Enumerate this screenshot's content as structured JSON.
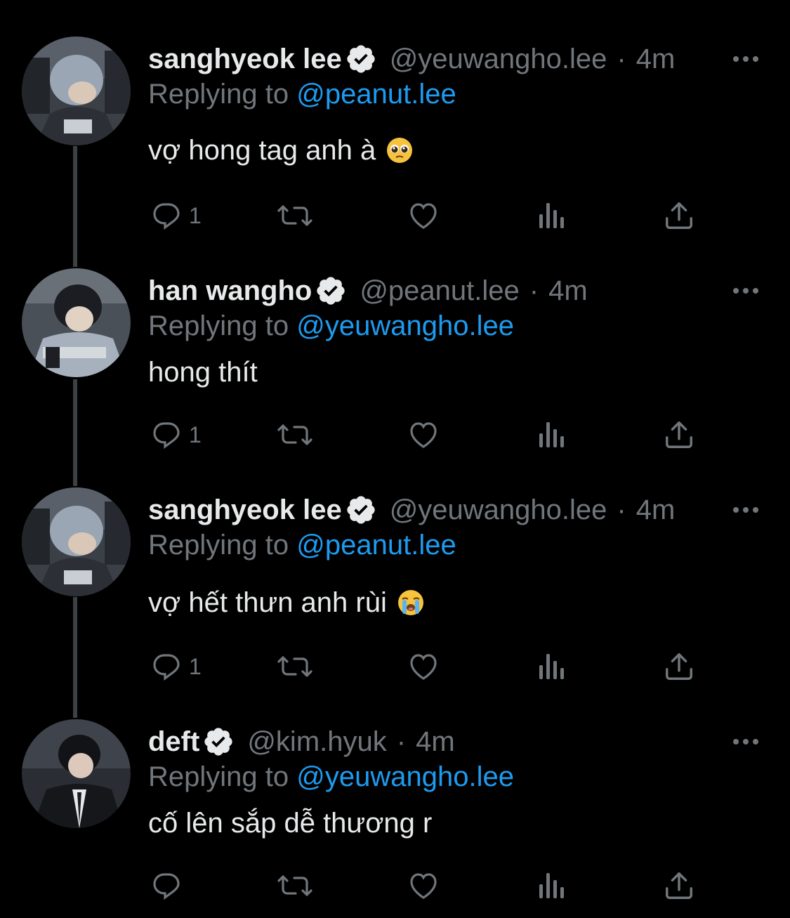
{
  "tweets": [
    {
      "name": "sanghyeok lee",
      "handle": "@yeuwangho.lee",
      "dot": "·",
      "time": "4m",
      "replying_prefix": "Replying to",
      "replying_to": "@peanut.lee",
      "text": "vợ hong tag anh à",
      "emoji": "pleading-face-emoji",
      "reply_count": "1",
      "avatar_icon": "avatar-photo",
      "verified_icon": "verified-badge-icon"
    },
    {
      "name": "han wangho",
      "handle": "@peanut.lee",
      "dot": "·",
      "time": "4m",
      "replying_prefix": "Replying to",
      "replying_to": "@yeuwangho.lee",
      "text": "hong thít",
      "emoji": "",
      "reply_count": "1",
      "avatar_icon": "avatar-photo",
      "verified_icon": "verified-badge-icon"
    },
    {
      "name": "sanghyeok lee",
      "handle": "@yeuwangho.lee",
      "dot": "·",
      "time": "4m",
      "replying_prefix": "Replying to",
      "replying_to": "@peanut.lee",
      "text": "vợ hết thưn anh rùi",
      "emoji": "loudly-crying-face-emoji",
      "reply_count": "1",
      "avatar_icon": "avatar-photo",
      "verified_icon": "verified-badge-icon"
    },
    {
      "name": "deft",
      "handle": "@kim.hyuk",
      "dot": "·",
      "time": "4m",
      "replying_prefix": "Replying to",
      "replying_to": "@yeuwangho.lee",
      "text": "cố lên sắp dễ thương r",
      "emoji": "",
      "reply_count": "",
      "avatar_icon": "avatar-photo",
      "verified_icon": "verified-badge-icon"
    }
  ],
  "colors": {
    "background": "#000000",
    "primary_text": "#e7e9ea",
    "secondary_text": "#71767b",
    "mention": "#1d9bf0",
    "thread_line": "#3e4144"
  },
  "action_icons": [
    "reply-icon",
    "retweet-icon",
    "like-icon",
    "views-icon",
    "share-icon"
  ]
}
